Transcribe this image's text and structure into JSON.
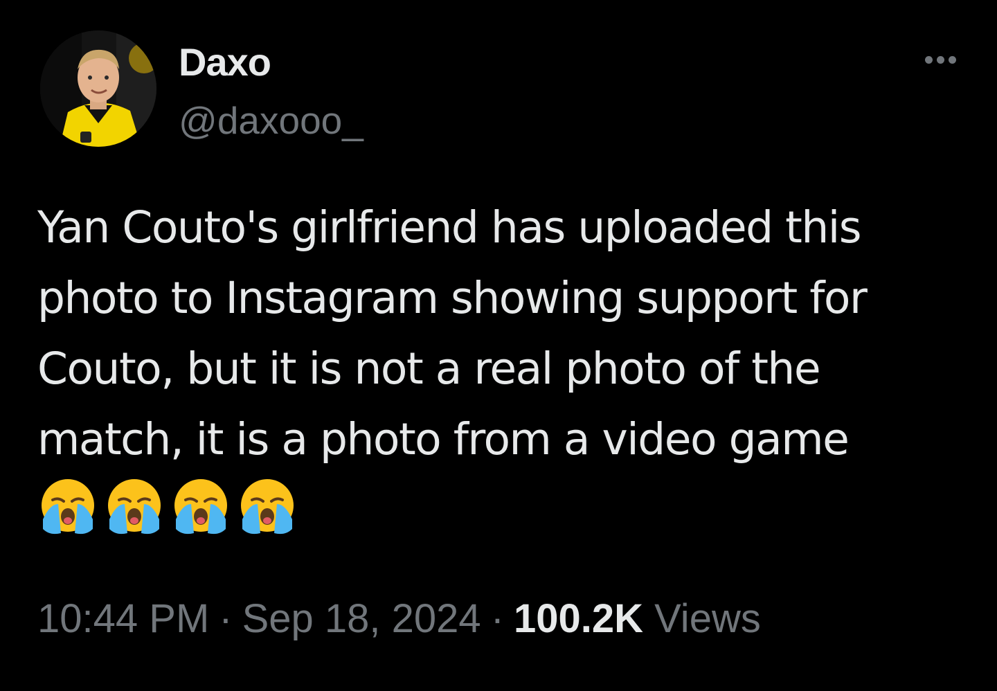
{
  "author": {
    "display_name": "Daxo",
    "handle": "@daxooo_",
    "avatar": "avatar-photo-person-yellow-jersey"
  },
  "actions": {
    "more_icon": "more-horizontal-icon"
  },
  "tweet": {
    "text": "Yan Couto's girlfriend has uploaded this\nphoto to Instagram showing support for\nCouto, but it is not a real photo of the\nmatch, it is a photo from a video game",
    "emojis": [
      "😭",
      "😭",
      "😭",
      "😭"
    ]
  },
  "meta": {
    "time": "10:44 PM",
    "separator": "·",
    "date": "Sep 18, 2024",
    "views_count": "100.2K",
    "views_label": "Views"
  },
  "colors": {
    "background": "#000000",
    "primary_text": "#e7e9ea",
    "secondary_text": "#71767b"
  }
}
